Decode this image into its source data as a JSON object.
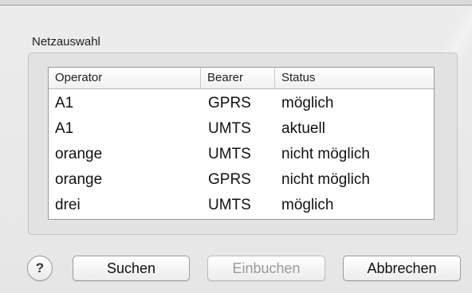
{
  "dialog": {
    "group_title": "Netzauswahl"
  },
  "table": {
    "columns": [
      "Operator",
      "Bearer",
      "Status"
    ],
    "rows": [
      {
        "operator": "A1",
        "bearer": "GPRS",
        "status": "möglich"
      },
      {
        "operator": "A1",
        "bearer": "UMTS",
        "status": "aktuell"
      },
      {
        "operator": "orange",
        "bearer": "UMTS",
        "status": "nicht möglich"
      },
      {
        "operator": "orange",
        "bearer": "GPRS",
        "status": "nicht möglich"
      },
      {
        "operator": "drei",
        "bearer": "UMTS",
        "status": "möglich"
      }
    ]
  },
  "buttons": {
    "help": "?",
    "search": "Suchen",
    "login": "Einbuchen",
    "cancel": "Abbrechen"
  }
}
